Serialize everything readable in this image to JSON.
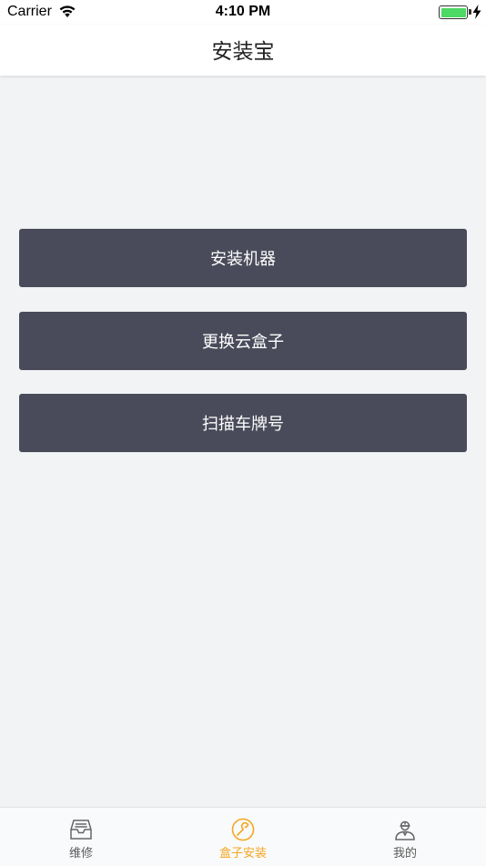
{
  "status_bar": {
    "carrier": "Carrier",
    "time": "4:10 PM"
  },
  "nav": {
    "title": "安装宝"
  },
  "actions": [
    {
      "label": "安装机器"
    },
    {
      "label": "更换云盒子"
    },
    {
      "label": "扫描车牌号"
    }
  ],
  "tabs": [
    {
      "label": "维修",
      "icon": "inbox-tray-icon",
      "active": false
    },
    {
      "label": "盒子安装",
      "icon": "wrench-circle-icon",
      "active": true
    },
    {
      "label": "我的",
      "icon": "worker-person-icon",
      "active": false
    }
  ],
  "colors": {
    "button_bg": "#4a4b5a",
    "active_tab": "#f5a623",
    "inactive_tab": "#5a5a5a",
    "battery": "#4cd964",
    "background": "#f2f3f5"
  }
}
